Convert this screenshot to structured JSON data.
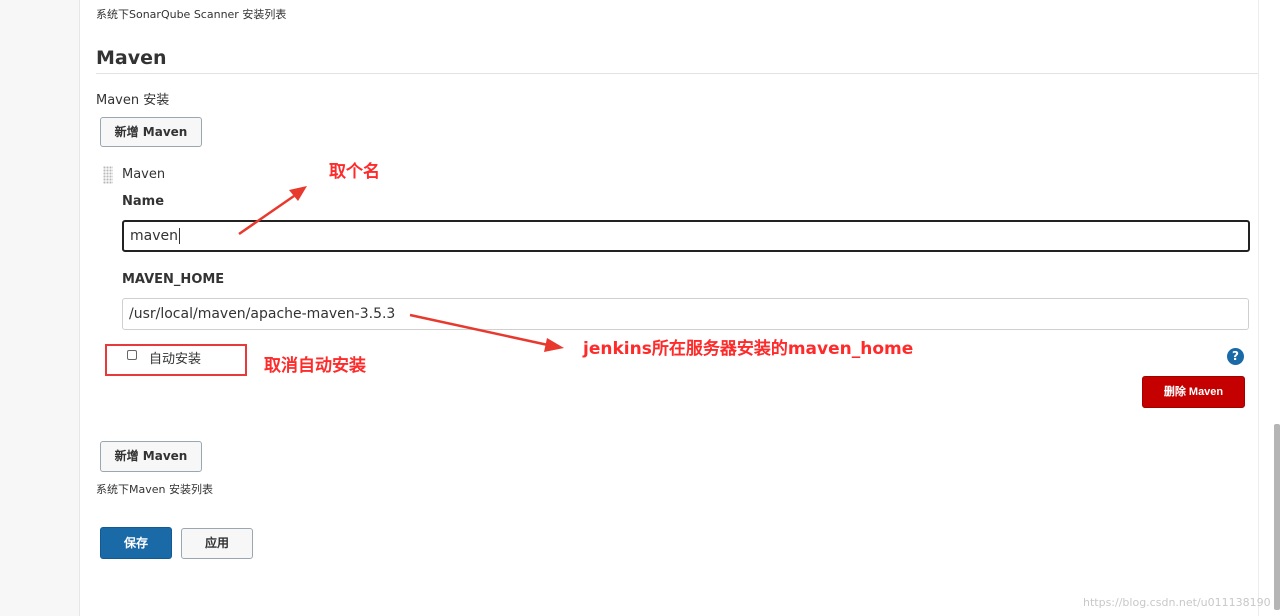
{
  "sonarqube_section": {
    "description": "系统下SonarQube Scanner 安装列表"
  },
  "maven_section": {
    "title": "Maven",
    "install_label": "Maven 安装",
    "add_button_top": "新增 Maven",
    "installation": {
      "header": "Maven",
      "name_label": "Name",
      "name_value": "maven",
      "home_label": "MAVEN_HOME",
      "home_value": "/usr/local/maven/apache-maven-3.5.3",
      "auto_install_label": "自动安装",
      "auto_install_checked": false,
      "help_label": "?",
      "delete_button": "删除 Maven"
    },
    "add_button_bottom": "新增 Maven",
    "list_description": "系统下Maven 安装列表"
  },
  "form_actions": {
    "save": "保存",
    "apply": "应用"
  },
  "annotations": {
    "name_note": "取个名",
    "home_note": "jenkins所在服务器安装的maven_home",
    "auto_note": "取消自动安装"
  },
  "watermark": "https://blog.csdn.net/u011138190",
  "colors": {
    "primary": "#1a6aa8",
    "danger": "#c40000",
    "annotation": "#ff2a2a"
  }
}
